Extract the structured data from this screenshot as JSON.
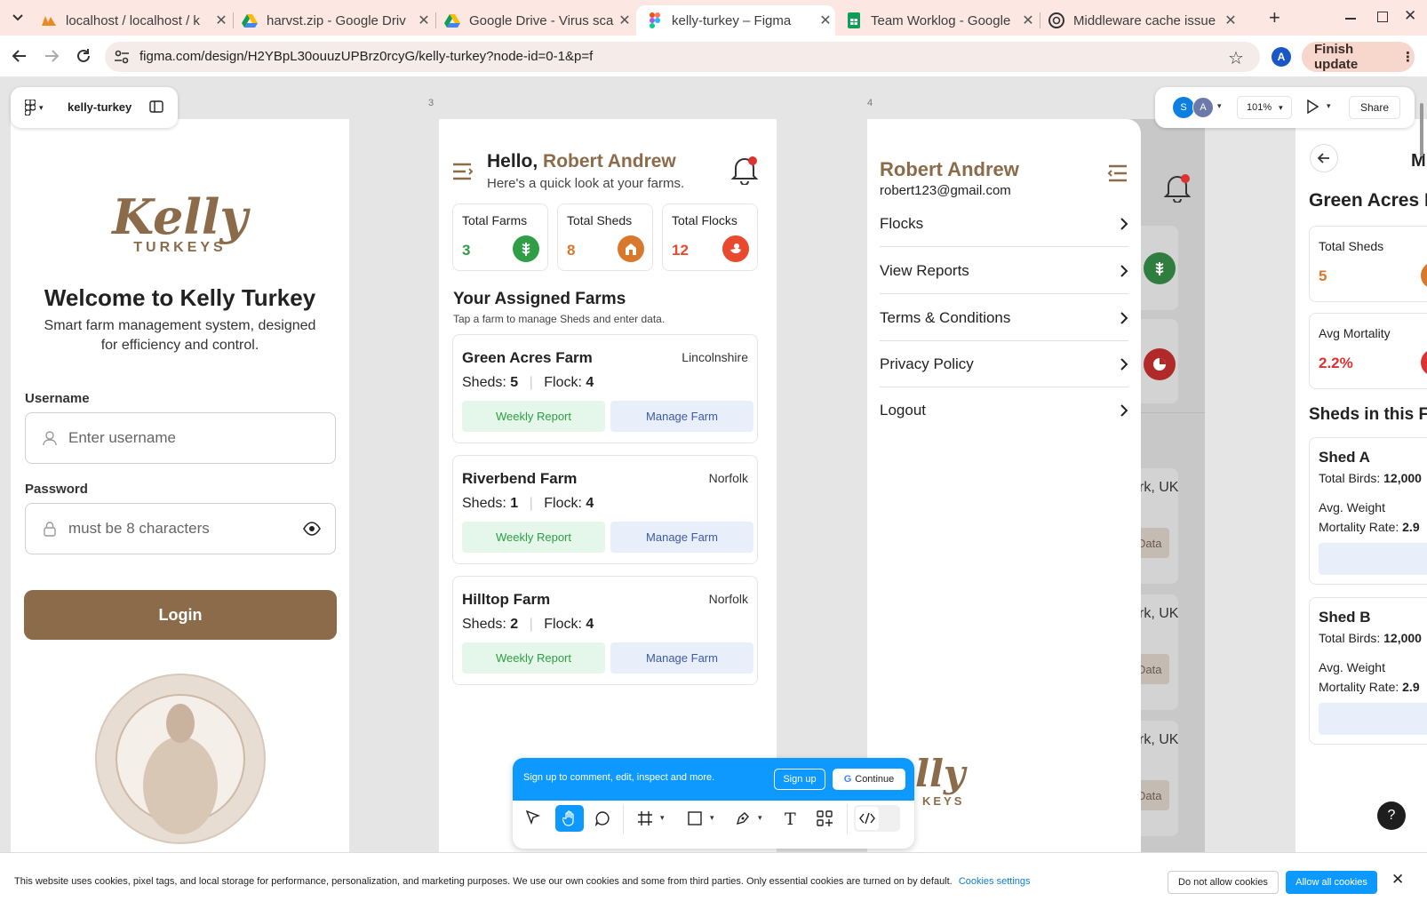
{
  "browser": {
    "tabs": [
      {
        "title": "localhost / localhost / k",
        "icon": "phpmyadmin-icon"
      },
      {
        "title": "harvst.zip - Google Driv",
        "icon": "google-drive-icon"
      },
      {
        "title": "Google Drive - Virus sca",
        "icon": "google-drive-icon"
      },
      {
        "title": "kelly-turkey – Figma",
        "icon": "figma-icon",
        "active": true
      },
      {
        "title": "Team Worklog - Google",
        "icon": "google-sheets-icon"
      },
      {
        "title": "Middleware cache issue",
        "icon": "chatgpt-icon"
      }
    ],
    "url": "figma.com/design/H2YBpL30ouuzUPBrz0rcyG/kelly-turkey?node-id=0-1&p=f",
    "profile_initial": "A",
    "finish_update": "Finish update"
  },
  "figma": {
    "file_name": "kelly-turkey",
    "zoom": "101%",
    "share": "Share",
    "avatars": [
      "S",
      "A"
    ],
    "frame_labels": {
      "f3": "3",
      "f4": "4"
    },
    "signup_bar": {
      "text": "Sign up to comment, edit, inspect and more.",
      "signup": "Sign up",
      "continue": "Continue"
    }
  },
  "login": {
    "logo_main": "Kelly",
    "logo_sub": "TURKEYS",
    "title": "Welcome to Kelly Turkey",
    "subtitle_line1": "Smart farm management system, designed",
    "subtitle_line2": "for efficiency and control.",
    "username_label": "Username",
    "username_placeholder": "Enter username",
    "password_label": "Password",
    "password_placeholder": "must be 8 characters",
    "login_button": "Login"
  },
  "dashboard": {
    "greeting": "Hello,",
    "user_name": "Robert Andrew",
    "sub": "Here's a quick look at your farms.",
    "stats": [
      {
        "label": "Total Farms",
        "value": "3",
        "color": "#2f9e44"
      },
      {
        "label": "Total Sheds",
        "value": "8",
        "color": "#d9772b"
      },
      {
        "label": "Total Flocks",
        "value": "12",
        "color": "#e8492f"
      }
    ],
    "section_title": "Your Assigned Farms",
    "section_sub": "Tap a farm to manage Sheds and enter data.",
    "farms": [
      {
        "name": "Green Acres Farm",
        "location": "Lincolnshire",
        "sheds_label": "Sheds:",
        "sheds": "5",
        "flock_label": "Flock:",
        "flock": "4"
      },
      {
        "name": "Riverbend Farm",
        "location": "Norfolk",
        "sheds_label": "Sheds:",
        "sheds": "1",
        "flock_label": "Flock:",
        "flock": "4"
      },
      {
        "name": "Hilltop Farm",
        "location": "Norfolk",
        "sheds_label": "Sheds:",
        "sheds": "2",
        "flock_label": "Flock:",
        "flock": "4"
      }
    ],
    "weekly_report": "Weekly Report",
    "manage_farm": "Manage Farm"
  },
  "menu": {
    "name": "Robert Andrew",
    "email": "robert123@gmail.com",
    "items": [
      "Flocks",
      "View Reports",
      "Terms & Conditions",
      "Privacy Policy",
      "Logout"
    ],
    "behind": {
      "loc1": "rk, UK",
      "loc2": "rk, UK",
      "loc3": "rk, UK",
      "btn": "Data"
    },
    "logo_partial_main": "lly",
    "logo_partial_sub": "KEYS"
  },
  "farm_detail": {
    "title_partial": "M",
    "farm_name": "Green Acres F",
    "stats": [
      {
        "label": "Total Sheds",
        "value": "5",
        "color": "#d9772b"
      },
      {
        "label": "Avg Mortality",
        "value": "2.2%",
        "color": "#e03131"
      }
    ],
    "section": "Sheds in this Fa",
    "sheds": [
      {
        "name": "Shed A",
        "birds_label": "Total Birds:",
        "birds": "12,000",
        "weight_label": "Avg. Weight",
        "mortality_label": "Mortality Rate:",
        "mortality": "2.9"
      },
      {
        "name": "Shed B",
        "birds_label": "Total Birds:",
        "birds": "12,000",
        "weight_label": "Avg. Weight",
        "mortality_label": "Mortality Rate:",
        "mortality": "2.9"
      }
    ]
  },
  "cookie": {
    "text": "This website uses cookies, pixel tags, and local storage for performance, personalization, and marketing purposes. We use our own cookies and some from third parties. Only essential cookies are turned on by default.",
    "settings": "Cookies settings",
    "deny": "Do not allow cookies",
    "allow": "Allow all cookies"
  },
  "help": "?",
  "colors": {
    "brand_brown": "#8b6b4a",
    "green": "#2f9e44",
    "orange": "#d9772b",
    "red": "#e8492f",
    "figma_blue": "#0d99ff"
  }
}
